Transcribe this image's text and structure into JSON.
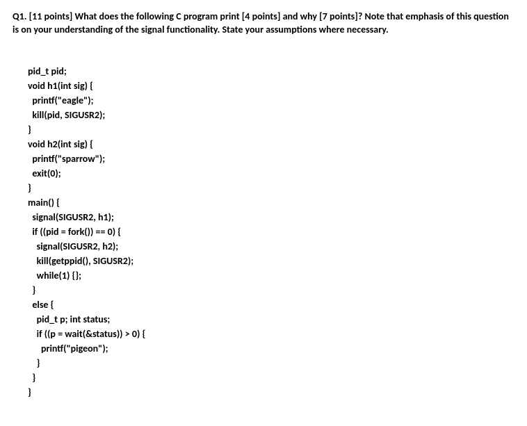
{
  "question": {
    "header": "Q1. [11 points] What does the following C program print [4 points] and why [7 points]? Note that emphasis of this question is on your understanding of the signal functionality. State your assumptions where necessary."
  },
  "code": {
    "line1": "pid_t pid;",
    "line2": "void h1(int sig) {",
    "line3": "  printf(\"eagle\");",
    "line4": "  kill(pid, SIGUSR2);",
    "line5": "}",
    "line6": "void h2(int sig) {",
    "line7": "  printf(\"sparrow\");",
    "line8": "  exit(0);",
    "line9": "}",
    "line10": "main() {",
    "line11": "  signal(SIGUSR2, h1);",
    "line12": "  if ((pid = fork()) == 0) {",
    "line13": "    signal(SIGUSR2, h2);",
    "line14": "    kill(getppid(), SIGUSR2);",
    "line15": "    while(1) {};",
    "line16": "  }",
    "line17": "  else {",
    "line18": "    pid_t p; int status;",
    "line19": "    if ((p = wait(&status)) > 0) {",
    "line20": "      printf(\"pigeon\");",
    "line21": "    }",
    "line22": "  }",
    "line23": "}"
  }
}
